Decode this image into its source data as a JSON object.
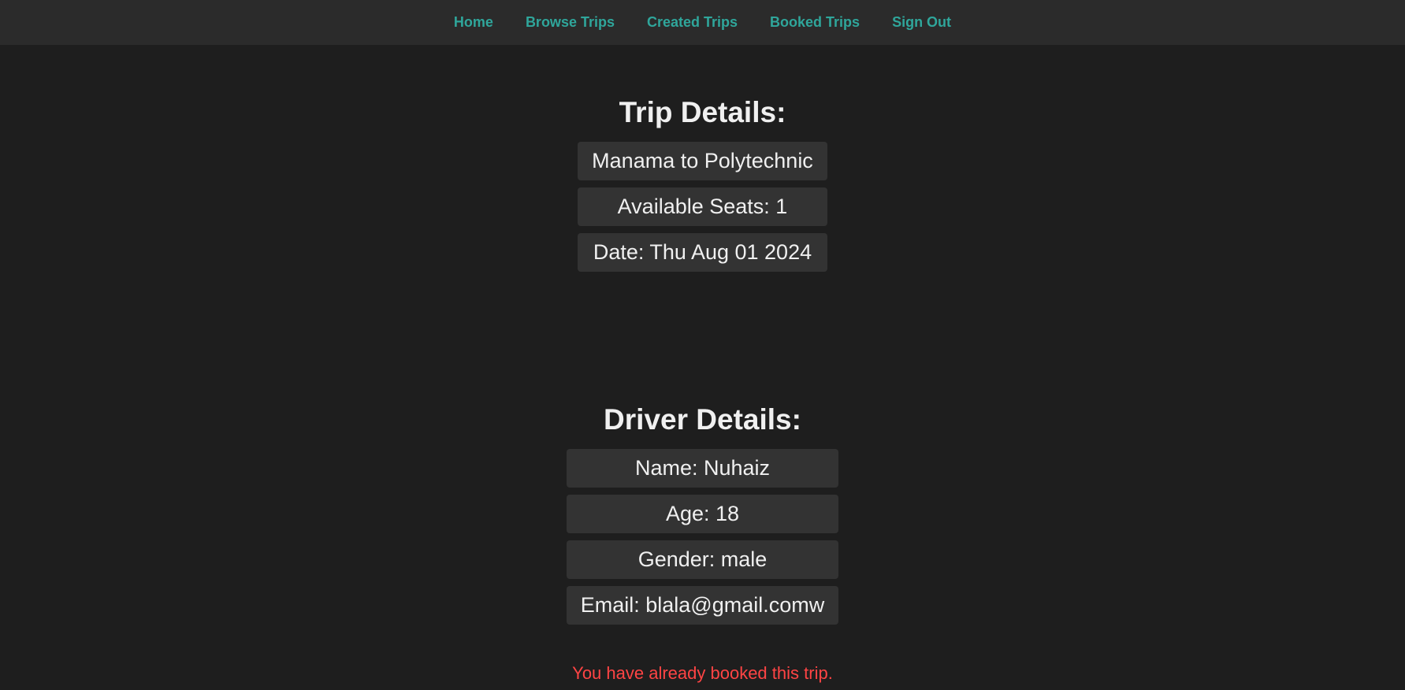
{
  "nav": {
    "items": [
      {
        "label": "Home"
      },
      {
        "label": "Browse Trips"
      },
      {
        "label": "Created Trips"
      },
      {
        "label": "Booked Trips"
      },
      {
        "label": "Sign Out"
      }
    ]
  },
  "trip": {
    "title": "Trip Details:",
    "route": "Manama to Polytechnic",
    "seats": "Available Seats: 1",
    "date": "Date: Thu Aug 01 2024"
  },
  "driver": {
    "title": "Driver Details:",
    "name": "Name: Nuhaiz",
    "age": "Age: 18",
    "gender": "Gender: male",
    "email": "Email: blala@gmail.comw"
  },
  "status": {
    "message": "You have already booked this trip."
  },
  "colors": {
    "background": "#1e1e1e",
    "navbar": "#2b2b2b",
    "accent": "#2fa69b",
    "card": "#333333",
    "error": "#ff4444"
  }
}
